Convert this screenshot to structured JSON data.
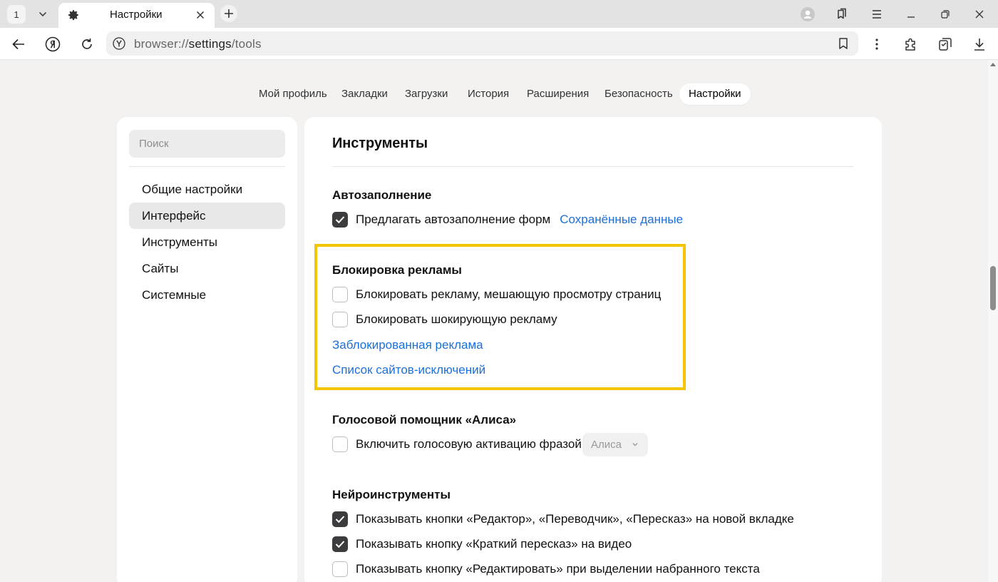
{
  "browser": {
    "tab_count": "1",
    "tab_title": "Настройки",
    "url_prefix": "browser://",
    "url_host": "settings",
    "url_path": "/tools"
  },
  "topnav": [
    {
      "label": "Мой профиль"
    },
    {
      "label": "Закладки"
    },
    {
      "label": "Загрузки"
    },
    {
      "label": "История"
    },
    {
      "label": "Расширения"
    },
    {
      "label": "Безопасность"
    },
    {
      "label": "Настройки",
      "active": true
    }
  ],
  "sidebar": {
    "search_placeholder": "Поиск",
    "items": [
      {
        "label": "Общие настройки"
      },
      {
        "label": "Интерфейс",
        "selected": true
      },
      {
        "label": "Инструменты"
      },
      {
        "label": "Сайты"
      },
      {
        "label": "Системные"
      }
    ]
  },
  "main": {
    "title": "Инструменты",
    "autofill": {
      "title": "Автозаполнение",
      "option": {
        "label": "Предлагать автозаполнение форм",
        "checked": true
      },
      "link": "Сохранённые данные"
    },
    "adblock": {
      "title": "Блокировка рекламы",
      "options": [
        {
          "label": "Блокировать рекламу, мешающую просмотру страниц",
          "checked": false
        },
        {
          "label": "Блокировать шокирующую рекламу",
          "checked": false
        }
      ],
      "link_blocked": "Заблокированная реклама",
      "link_exceptions": "Список сайтов-исключений"
    },
    "alice": {
      "title": "Голосовой помощник «Алиса»",
      "option": {
        "label": "Включить голосовую активацию фразой",
        "checked": false
      },
      "select_value": "Алиса"
    },
    "neuro": {
      "title": "Нейроинструменты",
      "options": [
        {
          "label": "Показывать кнопки «Редактор», «Переводчик», «Пересказ» на новой вкладке",
          "checked": true
        },
        {
          "label": "Показывать кнопку «Краткий пересказ» на видео",
          "checked": true
        },
        {
          "label": "Показывать кнопку «Редактировать» при выделении набранного текста",
          "checked": false
        }
      ]
    }
  },
  "colors": {
    "link": "#1a6fd9",
    "highlight": "#f5c600",
    "checkbox_checked": "#3c3c3f"
  },
  "icons": [
    "gear-icon",
    "close-icon",
    "plus-icon",
    "chevron-down-icon",
    "profile-icon",
    "collections-icon",
    "menu-icon",
    "minimize-icon",
    "restore-icon",
    "window-close-icon",
    "back-icon",
    "yandex-logo-icon",
    "reload-icon",
    "site-info-icon",
    "bookmark-icon",
    "more-icon",
    "extensions-icon",
    "tabs-icon",
    "download-icon",
    "checkmark-icon"
  ]
}
